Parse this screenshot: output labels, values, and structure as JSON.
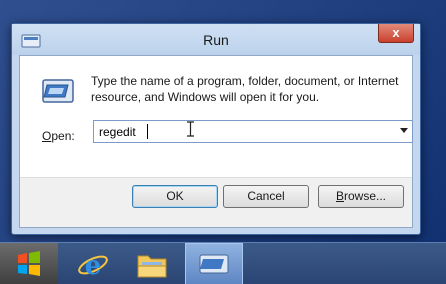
{
  "window": {
    "title": "Run",
    "close_glyph": "x",
    "icon": "run-dialog-icon"
  },
  "dialog": {
    "description": "Type the name of a program, folder, document, or Internet resource, and Windows will open it for you.",
    "open_label_prefix": "O",
    "open_label_rest": "pen:",
    "open_value": "regedit"
  },
  "buttons": {
    "ok_label": "OK",
    "cancel_label": "Cancel",
    "browse_prefix": "B",
    "browse_rest": "rowse..."
  },
  "taskbar": {
    "items": [
      {
        "icon": "windows-logo-icon"
      },
      {
        "icon": "internet-explorer-icon"
      },
      {
        "icon": "file-explorer-icon"
      },
      {
        "icon": "run-dialog-icon"
      }
    ]
  },
  "colors": {
    "accent": "#3c7fb1",
    "window_frame": "#c4d7ee",
    "close_red": "#c9412e",
    "taskbar": "#2a4573"
  }
}
